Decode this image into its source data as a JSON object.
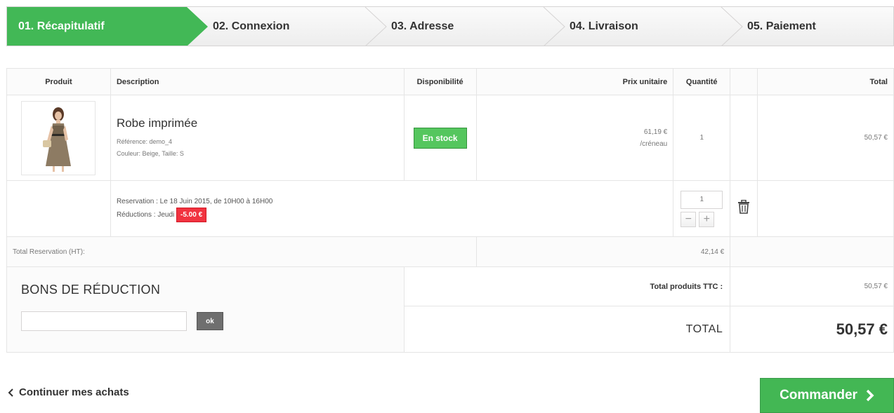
{
  "steps": [
    {
      "label": "01. Récapitulatif",
      "active": true
    },
    {
      "label": "02. Connexion",
      "active": false
    },
    {
      "label": "03. Adresse",
      "active": false
    },
    {
      "label": "04. Livraison",
      "active": false
    },
    {
      "label": "05. Paiement",
      "active": false
    }
  ],
  "table": {
    "headers": {
      "product": "Produit",
      "description": "Description",
      "availability": "Disponibilité",
      "unit_price": "Prix unitaire",
      "quantity": "Quantité",
      "total": "Total"
    },
    "item": {
      "name": "Robe imprimée",
      "reference": "Référence: demo_4",
      "attributes": "Couleur: Beige, Taille: S",
      "availability": "En stock",
      "unit_price": "61,19 €",
      "unit": "/créneau",
      "quantity": "1",
      "total": "50,57 €"
    },
    "reservation": {
      "line": "Reservation : Le 18 Juin 2015, de 10H00 à 16H00",
      "discount_label": "Réductions : Jeudi",
      "discount_value": "-5.00 €",
      "quantity": "1",
      "minus": "−",
      "plus": "+"
    },
    "total_reservation": {
      "label": "Total Reservation (HT):",
      "value": "42,14 €"
    }
  },
  "voucher": {
    "title": "BONS DE RÉDUCTION",
    "input_value": "",
    "button": "ok"
  },
  "totals": {
    "products_label": "Total produits TTC :",
    "products_value": "50,57 €",
    "total_label": "TOTAL",
    "total_value": "50,57 €"
  },
  "actions": {
    "continue": "Continuer mes achats",
    "order": "Commander"
  },
  "colors": {
    "accent": "#42b856",
    "discount": "#f13340"
  }
}
